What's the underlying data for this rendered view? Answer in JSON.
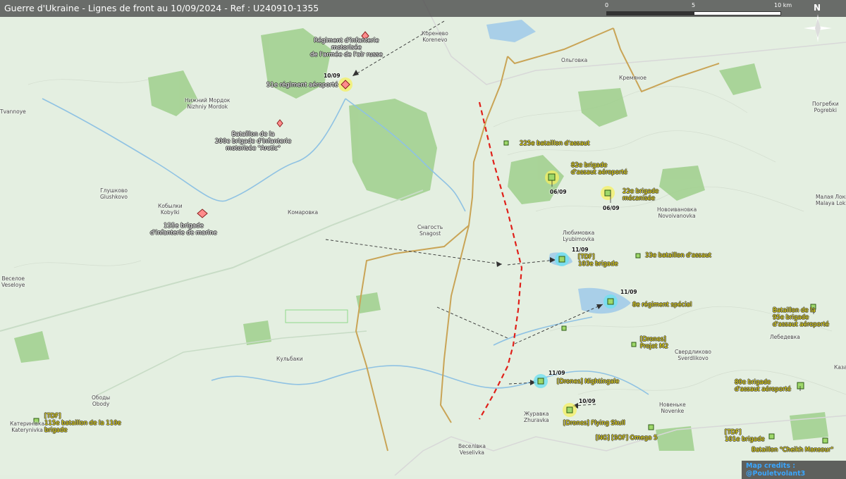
{
  "header": {
    "title": "Guerre d'Ukraine - Lignes de front au 10/09/2024 - Ref : U240910-1355"
  },
  "scale": {
    "ticks": [
      "0",
      "5",
      "10 km"
    ]
  },
  "compass": {
    "label": "N"
  },
  "places": [
    {
      "id": "korenevo",
      "text": "Коренево\nKorenevo"
    },
    {
      "id": "olgovka",
      "text": "Ольговка"
    },
    {
      "id": "kremyanoe",
      "text": "Кремяное"
    },
    {
      "id": "pogrebki",
      "text": "Погребки\nPogrebki"
    },
    {
      "id": "nizhny_mordok",
      "text": "Нижний Мордок\nNizhniy Mordok"
    },
    {
      "id": "ivanovoe",
      "text": "Tvannoye"
    },
    {
      "id": "glushkovo",
      "text": "Глушково\nGlushkovo"
    },
    {
      "id": "kobylki",
      "text": "Кобылки\nKobylki"
    },
    {
      "id": "komarovka",
      "text": "Комаровка"
    },
    {
      "id": "snagost",
      "text": "Снагость\nSnagost"
    },
    {
      "id": "lyubimovka",
      "text": "Любимовка\nLyubimovka"
    },
    {
      "id": "novoivanovka",
      "text": "Новоивановка\nNovoivanovka"
    },
    {
      "id": "malaya_lokn",
      "text": "Малая Локн\nMalaya Lokn"
    },
    {
      "id": "veseloe",
      "text": "Веселое\nVeseloye"
    },
    {
      "id": "kulbaki",
      "text": "Кульбаки"
    },
    {
      "id": "sverdlikovo",
      "text": "Свердликово\nSverdlikovo"
    },
    {
      "id": "lebedevka",
      "text": "Лебедевка"
    },
    {
      "id": "obody",
      "text": "Ободы\nObody"
    },
    {
      "id": "katerynivka",
      "text": "Катеринівка\nKaterynivka"
    },
    {
      "id": "zhuravka",
      "text": "Журавка\nZhuravka"
    },
    {
      "id": "novenke",
      "text": "Новенькe\nNovenke"
    },
    {
      "id": "veselivka",
      "text": "Веселівка\nVeselivka"
    },
    {
      "id": "kaza",
      "text": "Каза"
    }
  ],
  "ru_units": [
    {
      "id": "motor_rifle",
      "text": "Régiment d'infanterie\nmotorisée\nde l'armée de l'air russe"
    },
    {
      "id": "airborne51",
      "text": "51e régiment aéroporté"
    },
    {
      "id": "arctic",
      "text": "Bataillon de la\n200e brigade d'infanterie\nmotorisée \"Arctic\""
    },
    {
      "id": "marine155",
      "text": "155e brigade\nd'infanterie de marine"
    }
  ],
  "ua_units": [
    {
      "id": "assault225",
      "text": "225e bataillon d'assaut"
    },
    {
      "id": "brig82",
      "text": "82e brigade\nd'assaut aéroporté"
    },
    {
      "id": "brig22",
      "text": "22e brigade\nmécanisée"
    },
    {
      "id": "tdf103",
      "text": "[TDF]\n103e brigade"
    },
    {
      "id": "assault33",
      "text": "33e bataillon d'assaut"
    },
    {
      "id": "special8",
      "text": "8e régiment spécial"
    },
    {
      "id": "brig95",
      "text": "Bataillon de la\n95e brigade\nd'assaut aéroporté"
    },
    {
      "id": "drones_m2",
      "text": "[Drones]\nProjet M2"
    },
    {
      "id": "nightingale",
      "text": "[Drones] Nightingale"
    },
    {
      "id": "flying_skull",
      "text": "[Drones] Flying Skull"
    },
    {
      "id": "omega5",
      "text": "[NG] [SOF] Omega 5"
    },
    {
      "id": "brig80",
      "text": "80e brigade\nd'assaut aéroporté"
    },
    {
      "id": "tdf101",
      "text": "[TDF]\n101e brigade"
    },
    {
      "id": "cheikh",
      "text": "Bataillon \"Cheikh Mansour\""
    },
    {
      "id": "tdf115",
      "text": "[TDF]\n115e bataillon de la 110e\nbrigade"
    }
  ],
  "dates": [
    {
      "id": "d_airborne51",
      "text": "10/09"
    },
    {
      "id": "d_brig82",
      "text": "06/09"
    },
    {
      "id": "d_brig22",
      "text": "06/09"
    },
    {
      "id": "d_tdf103",
      "text": "11/09"
    },
    {
      "id": "d_special8",
      "text": "11/09"
    },
    {
      "id": "d_nightingale",
      "text": "11/09"
    },
    {
      "id": "d_flying_skull",
      "text": "10/09"
    }
  ],
  "credits": "Map credits : @Pouletvolant3",
  "colors": {
    "russia_unit": "#ff8c8c",
    "ukraine_unit": "#9ed86a",
    "front_line": "#e0201a",
    "border": "#c9a456",
    "forest": "#9fcf8c",
    "water": "#a9cfe8",
    "highlight_yellow": "#f5f060",
    "highlight_cyan": "#6fe0f0"
  }
}
